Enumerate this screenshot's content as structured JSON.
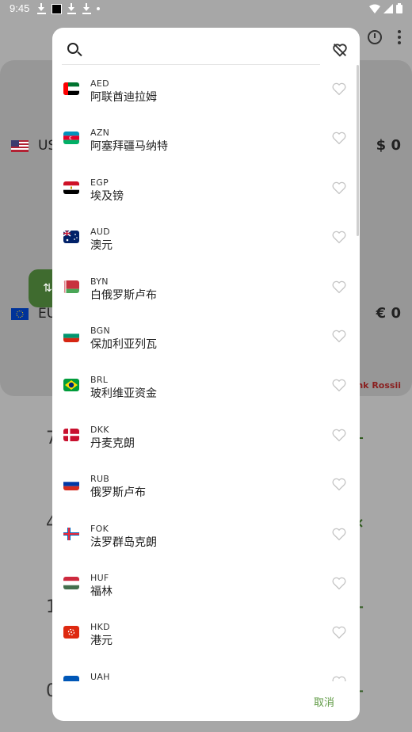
{
  "status_bar": {
    "time": "9:45"
  },
  "background": {
    "from_currency": {
      "code_partial": "US",
      "amount": "$ 0"
    },
    "to_currency": {
      "code_partial": "EU",
      "amount": "€ 0"
    },
    "source": "Bank Rossii",
    "keypad_rows": [
      {
        "num": "7",
        "op": "÷"
      },
      {
        "num": "4",
        "op": "×"
      },
      {
        "num": "1",
        "op": "−"
      },
      {
        "num": "0",
        "op": "+"
      }
    ]
  },
  "dialog": {
    "search": {
      "placeholder": "",
      "value": ""
    },
    "cancel_label": "取消",
    "currencies": [
      {
        "code": "AED",
        "name": "阿联酋迪拉姆",
        "flag": "flag-uae"
      },
      {
        "code": "AZN",
        "name": "阿塞拜疆马纳特",
        "flag": "flag-azerbaijan"
      },
      {
        "code": "EGP",
        "name": "埃及镑",
        "flag": "flag-egypt"
      },
      {
        "code": "AUD",
        "name": "澳元",
        "flag": "flag-australia"
      },
      {
        "code": "BYN",
        "name": "白俄罗斯卢布",
        "flag": "flag-belarus"
      },
      {
        "code": "BGN",
        "name": "保加利亚列瓦",
        "flag": "flag-bulgaria"
      },
      {
        "code": "BRL",
        "name": "玻利维亚资金",
        "flag": "flag-brazil"
      },
      {
        "code": "DKK",
        "name": "丹麦克朗",
        "flag": "flag-denmark"
      },
      {
        "code": "RUB",
        "name": "俄罗斯卢布",
        "flag": "flag-russia"
      },
      {
        "code": "FOK",
        "name": "法罗群岛克朗",
        "flag": "flag-faroe"
      },
      {
        "code": "HUF",
        "name": "福林",
        "flag": "flag-hungary"
      },
      {
        "code": "HKD",
        "name": "港元",
        "flag": "flag-hongkong"
      },
      {
        "code": "UAH",
        "name": "",
        "flag": "flag-ukraine"
      }
    ]
  }
}
